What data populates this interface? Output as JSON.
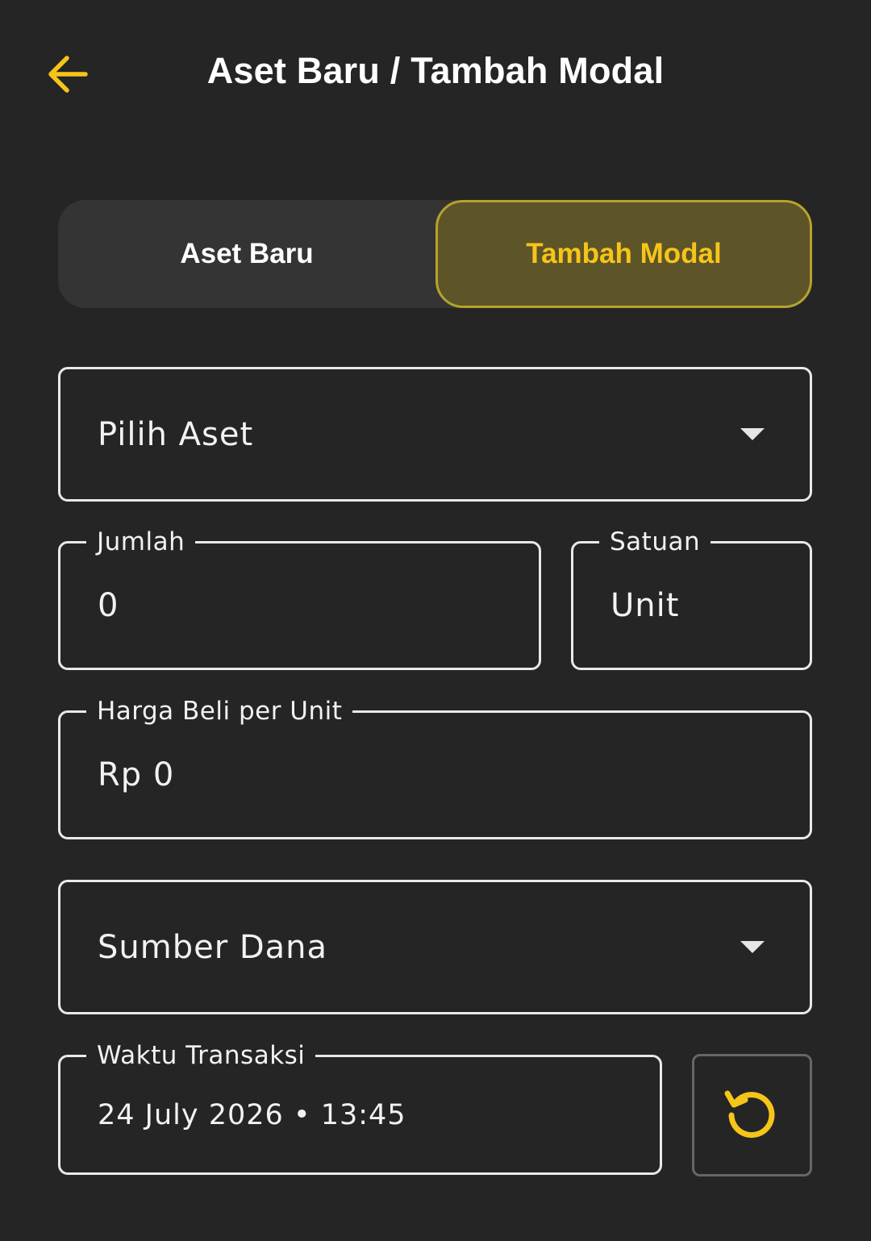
{
  "header": {
    "title": "Aset Baru / Tambah Modal",
    "back_icon": "arrow-left-icon"
  },
  "segmented": {
    "options": [
      {
        "label": "Aset Baru",
        "selected": false
      },
      {
        "label": "Tambah Modal",
        "selected": true
      }
    ]
  },
  "form": {
    "aset": {
      "value": "Pilih Aset"
    },
    "jumlah": {
      "label": "Jumlah",
      "value": "0"
    },
    "satuan": {
      "label": "Satuan",
      "value": "Unit"
    },
    "harga": {
      "label": "Harga Beli per Unit",
      "value": "Rp 0"
    },
    "sumber_dana": {
      "value": "Sumber Dana"
    },
    "waktu": {
      "label": "Waktu Transaksi",
      "value": "24 July 2026 • 13:45"
    },
    "reset_icon": "refresh-icon"
  },
  "colors": {
    "background": "#252525",
    "accent": "#f6c51a",
    "segment_selected_bg": "#5d5428",
    "field_border": "#e9e9e9"
  }
}
